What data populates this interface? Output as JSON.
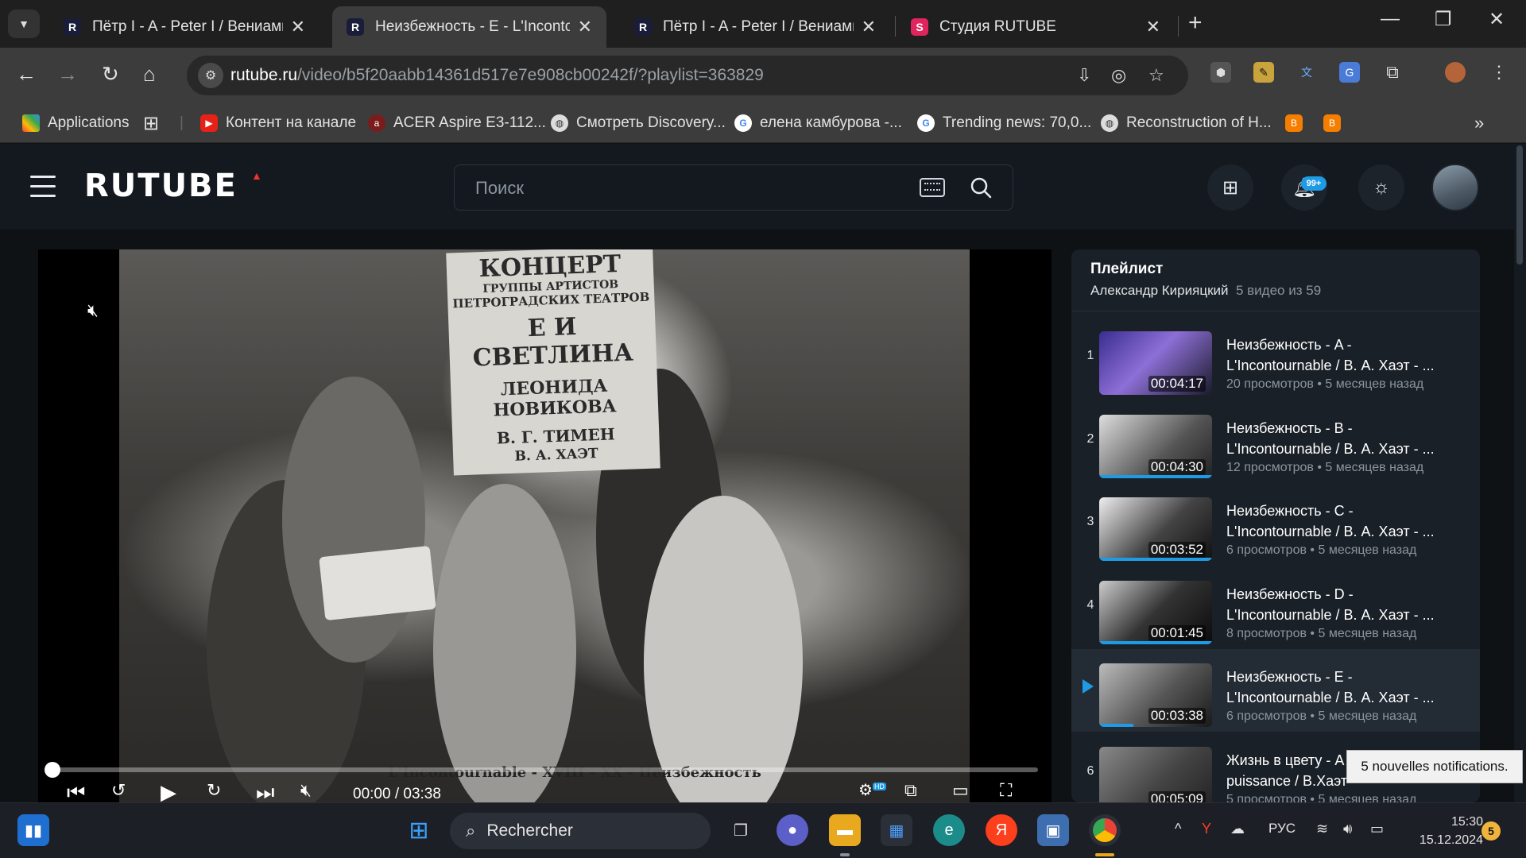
{
  "browser": {
    "tabs": [
      {
        "title": "Пётр I - A - Peter I / Вениамин",
        "active": false
      },
      {
        "title": "Неизбежность - E - L'Incontour",
        "active": true
      },
      {
        "title": "Пётр I - A - Peter I / Вениамин",
        "active": false
      },
      {
        "title": "Студия RUTUBE",
        "active": false
      }
    ],
    "url_host": "rutube.ru",
    "url_path": "/video/b5f20aabb14361d517e7e908cb00242f/?playlist=363829",
    "bookmarks": [
      {
        "label": "Applications",
        "icon": "apps-grid-icon"
      },
      {
        "label": "Контент на канале",
        "icon": "youtube-icon"
      },
      {
        "label": "ACER Aspire E3-112...",
        "icon": "acer-icon"
      },
      {
        "label": "Смотреть Discovery...",
        "icon": "globe-icon"
      },
      {
        "label": "елена камбурова -...",
        "icon": "google-icon"
      },
      {
        "label": "Trending news: 70,0...",
        "icon": "google-icon"
      },
      {
        "label": "Reconstruction of H...",
        "icon": "globe-icon"
      }
    ]
  },
  "site": {
    "logo": "RUTUBE",
    "search_placeholder": "Поиск",
    "notifications_badge": "99+"
  },
  "player": {
    "poster_lines": [
      "КОНЦЕРТ",
      "ГРУППЫ АРТИСТОВ",
      "ПЕТРОГРАДСКИХ ТЕАТРОВ",
      "Е И СВЕТЛИНА",
      "ЛЕОНИДА НОВИКОВА",
      "В. Г. ТИМЕН",
      "В. А. ХАЭТ"
    ],
    "subtitle": "L'Incontournable - XVIII - XX - Неизбежность",
    "current_time": "00:00",
    "duration": "03:38",
    "time_display": "00:00 / 03:38",
    "progress": 0,
    "hd_label": "HD"
  },
  "playlist": {
    "title": "Плейлист",
    "author": "Александр Кирияцкий",
    "count": "5 видео из 59",
    "items": [
      {
        "num": "1",
        "line1": "Неизбежность - A -",
        "line2": "L'Incontournable / В. А. Хаэт - ...",
        "duration": "00:04:17",
        "views": "20 просмотров",
        "ago": "5 месяцев назад",
        "watched": 0,
        "current": false
      },
      {
        "num": "2",
        "line1": "Неизбежность - B -",
        "line2": "L'Incontournable / В. А. Хаэт - ...",
        "duration": "00:04:30",
        "views": "12 просмотров",
        "ago": "5 месяцев назад",
        "watched": 1,
        "current": false
      },
      {
        "num": "3",
        "line1": "Неизбежность - C -",
        "line2": "L'Incontournable / В. А. Хаэт - ...",
        "duration": "00:03:52",
        "views": "6 просмотров",
        "ago": "5 месяцев назад",
        "watched": 1,
        "current": false
      },
      {
        "num": "4",
        "line1": "Неизбежность - D -",
        "line2": "L'Incontournable / В. А. Хаэт - ...",
        "duration": "00:01:45",
        "views": "8 просмотров",
        "ago": "5 месяцев назад",
        "watched": 1,
        "current": false
      },
      {
        "num": "",
        "line1": "Неизбежность - E -",
        "line2": "L'Incontournable / В. А. Хаэт - ...",
        "duration": "00:03:38",
        "views": "6 просмотров",
        "ago": "5 месяцев назад",
        "watched": 0.3,
        "current": true
      },
      {
        "num": "6",
        "line1": "Жизнь в цвету - A - La Vie",
        "line2": "puissance / В.Хаэт",
        "duration": "00:05:09",
        "views": "5 просмотров",
        "ago": "5 месяцев назад",
        "watched": 0,
        "current": false
      }
    ]
  },
  "tooltip": "5 nouvelles notifications.",
  "taskbar": {
    "search_label": "Rechercher",
    "lang": "РУС",
    "time": "15:30",
    "date": "15.12.2024",
    "notif_count": "5"
  }
}
